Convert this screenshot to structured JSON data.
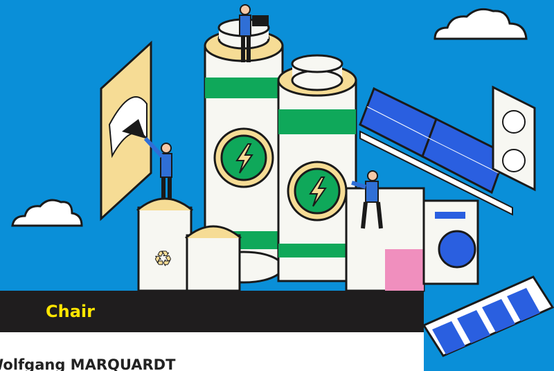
{
  "section": {
    "title": "Chair",
    "person_name": "Wolfgang MARQUARDT"
  },
  "colors": {
    "background": "#0a8fd8",
    "header_bar": "#1f1d1e",
    "header_text": "#ffe600",
    "battery_green": "#0fa85a",
    "panel_blue": "#2a5fe0"
  },
  "illustration": {
    "subject": "renewable energy storage",
    "icons": [
      "cloud-icon",
      "battery-icon",
      "lightning-bolt-icon",
      "solar-panel-icon",
      "power-outlet-icon",
      "washing-machine-icon",
      "recycle-bin-icon",
      "gauge-icon",
      "battery-level-icon",
      "person-figure"
    ]
  }
}
